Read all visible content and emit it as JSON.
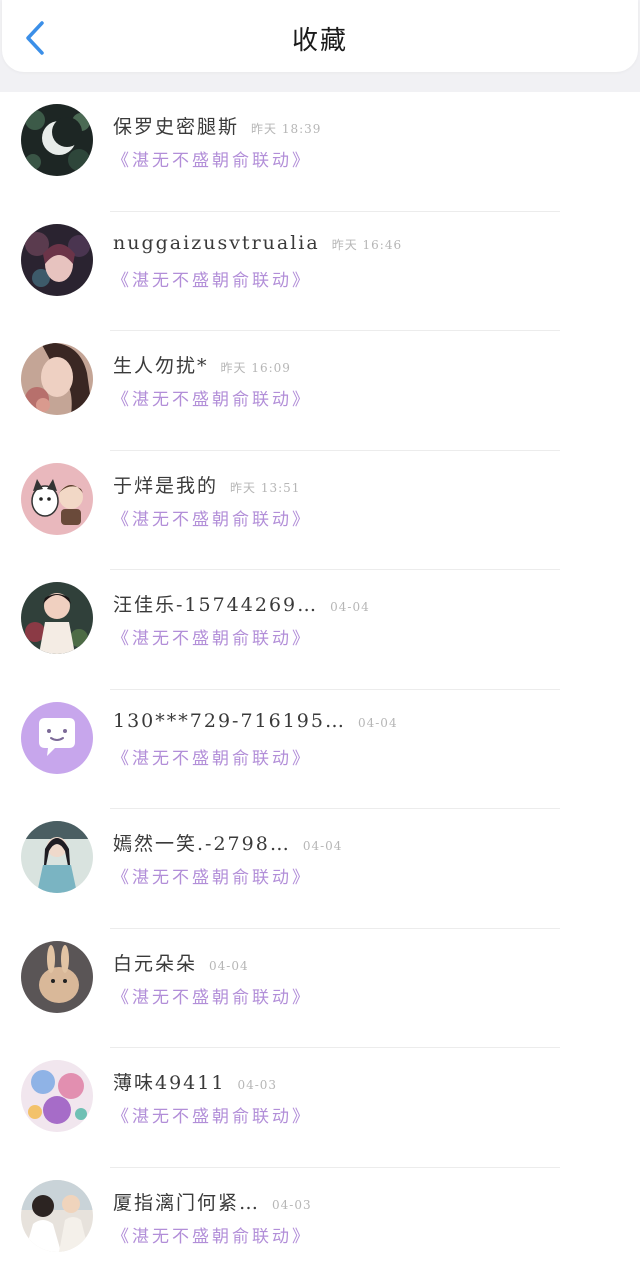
{
  "header": {
    "title": "收藏",
    "back_icon": "chevron-left-icon",
    "accent_color": "#3b8fe8"
  },
  "items": [
    {
      "name": "保罗史密腿斯",
      "time": "昨天 18:39",
      "content": "《湛无不盛朝俞联动》"
    },
    {
      "name": "nuggaizusvtrualia",
      "time": "昨天 16:46",
      "content": "《湛无不盛朝俞联动》"
    },
    {
      "name": "生人勿扰*",
      "time": "昨天 16:09",
      "content": "《湛无不盛朝俞联动》"
    },
    {
      "name": "于烊是我的",
      "time": "昨天 13:51",
      "content": "《湛无不盛朝俞联动》"
    },
    {
      "name": "汪佳乐-15744269…",
      "time": "04-04",
      "content": "《湛无不盛朝俞联动》"
    },
    {
      "name": "130***729-716195…",
      "time": "04-04",
      "content": "《湛无不盛朝俞联动》"
    },
    {
      "name": "嫣然一笑.-2798…",
      "time": "04-04",
      "content": "《湛无不盛朝俞联动》"
    },
    {
      "name": "白元朵朵",
      "time": "04-04",
      "content": "《湛无不盛朝俞联动》"
    },
    {
      "name": "薄味49411",
      "time": "04-03",
      "content": "《湛无不盛朝俞联动》"
    },
    {
      "name": "厦指漓门何紧…",
      "time": "04-03",
      "content": "《湛无不盛朝俞联动》"
    }
  ],
  "colors": {
    "content_purple": "#b28ed8",
    "name_text": "#3a3a3a",
    "time_text": "#b6b6b6"
  }
}
